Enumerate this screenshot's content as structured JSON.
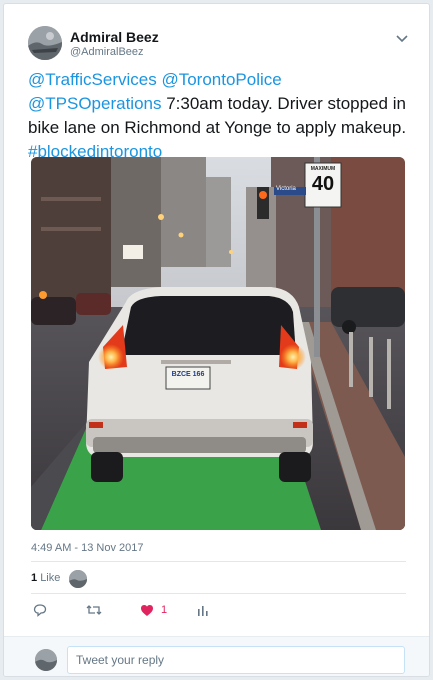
{
  "user": {
    "display_name": "Admiral Beez",
    "handle": "@AdmiralBeez",
    "avatar_icon": "user-avatar-image"
  },
  "tweet": {
    "mentions": [
      "@TrafficServices",
      "@TorontoPolice",
      "@TPSOperations"
    ],
    "body": "7:30am today. Driver stopped in bike lane on Richmond at Yonge to apply makeup.",
    "hashtag": "#blockedintoronto",
    "link_color": "#1b95e0"
  },
  "photo": {
    "street_sign": "Victoria",
    "speed_sign_top": "MAXIMUM",
    "speed_sign_value": "40",
    "plate_text": "BZCE 166"
  },
  "meta": {
    "timestamp": "4:49 AM - 13 Nov 2017",
    "likes_count": "1",
    "likes_label": "Like"
  },
  "actions": {
    "like_count": "1",
    "reply_icon": "reply-icon",
    "retweet_icon": "retweet-icon",
    "like_icon": "heart-icon",
    "analytics_icon": "analytics-icon",
    "like_color": "#e0245e"
  },
  "reply": {
    "placeholder": "Tweet your reply"
  }
}
